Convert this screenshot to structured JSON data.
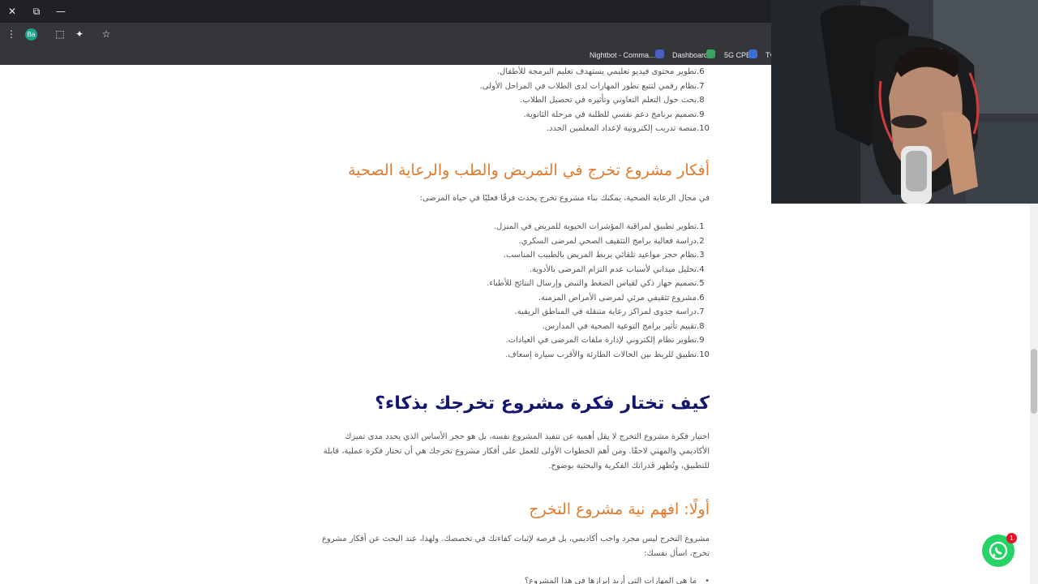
{
  "window": {
    "close_glyph": "✕",
    "restore_glyph": "⧉",
    "minimize_glyph": "—"
  },
  "toolbar": {
    "menu_glyph": "⋮",
    "profile_initials": "Ba",
    "extensions_glyph": "⬚",
    "puzzle_glyph": "✦",
    "star_glyph": "☆"
  },
  "bookmarks": [
    {
      "label": "Nightbot - Comma...",
      "icon_color": "#4a5fc1"
    },
    {
      "label": "Dashboard",
      "icon_color": "#3aa55c"
    },
    {
      "label": "5G CPE",
      "icon_color": "#3a6fd8"
    },
    {
      "label": "Tv",
      "icon_color": "#888888"
    }
  ],
  "article": {
    "list_a": [
      {
        "n": "6.",
        "t": "تطوير محتوى فيديو تعليمي يستهدف تعليم البرمجة للأطفال."
      },
      {
        "n": "7.",
        "t": "نظام رقمي لتتبع تطور المهارات لدى الطلاب في المراحل الأولى."
      },
      {
        "n": "8.",
        "t": "بحث حول التعلم التعاوني وتأثيره في تحصيل الطلاب."
      },
      {
        "n": "9.",
        "t": "تصميم برنامج دعم نفسي للطلبة في مرحلة الثانوية."
      },
      {
        "n": "10.",
        "t": "منصة تدريب إلكترونية لإعداد المعلمين الجدد."
      }
    ],
    "heading_medical": "أفكار مشروع تخرج في التمريض والطب والرعاية الصحية",
    "intro_medical": "في مجال الرعاية الصحية، يمكنك بناء مشروع تخرج يحدث فرقًا فعليًا في حياة المرضى:",
    "list_b": [
      {
        "n": "1.",
        "t": "تطوير تطبيق لمراقبة المؤشرات الحيوية للمريض في المنزل."
      },
      {
        "n": "2.",
        "t": "دراسة فعالية برامج التثقيف الصحي لمرضى السكري."
      },
      {
        "n": "3.",
        "t": "نظام حجز مواعيد تلقائي يربط المريض بالطبيب المناسب."
      },
      {
        "n": "4.",
        "t": "تحليل ميداني لأسباب عدم التزام المرضى بالأدوية."
      },
      {
        "n": "5.",
        "t": "تصميم جهاز ذكي لقياس الضغط والنبض وإرسال النتائج للأطباء."
      },
      {
        "n": "6.",
        "t": "مشروع تثقيفي مرئي لمرضى الأمراض المزمنة."
      },
      {
        "n": "7.",
        "t": "دراسة جدوى لمراكز رعاية متنقلة في المناطق الريفية."
      },
      {
        "n": "8.",
        "t": "تقييم تأثير برامج التوعية الصحية في المدارس."
      },
      {
        "n": "9.",
        "t": "تطوير نظام إلكتروني لإدارة ملفات المرضى في العيادات."
      },
      {
        "n": "10.",
        "t": "تطبيق للربط بين الحالات الطارئة والأقرب سيارة إسعاف."
      }
    ],
    "heading_choose": "كيف تختار فكرة مشروع تخرجك بذكاء؟",
    "para_choose": "اختيار فكرة مشروع التخرج لا يقل أهمية عن تنفيذ المشروع نفسه، بل هو حجر الأساس الذي يحدد مدى تميزك الأكاديمي والمهني لاحقًا. ومن أهم الخطوات الأولى للعمل على أفكار مشروع تخرجك هي أن تختار فكرة عملية، قابلة للتطبيق، وتُظهر قدراتك الفكرية والبحثية بوضوح.",
    "heading_first": "أولًا: افهم نية مشروع التخرج",
    "para_first": "مشروع التخرج ليس مجرد واجب أكاديمي، بل فرصة لإثبات كفاءتك في تخصصك. ولهذا، عند البحث عن أفكار مشروع تخرج، اسأل نفسك:",
    "bullet_cut": "ما هي المهارات التي أريد إبرازها في هذا المشروع؟"
  },
  "chat_widget": {
    "badge": "1"
  }
}
